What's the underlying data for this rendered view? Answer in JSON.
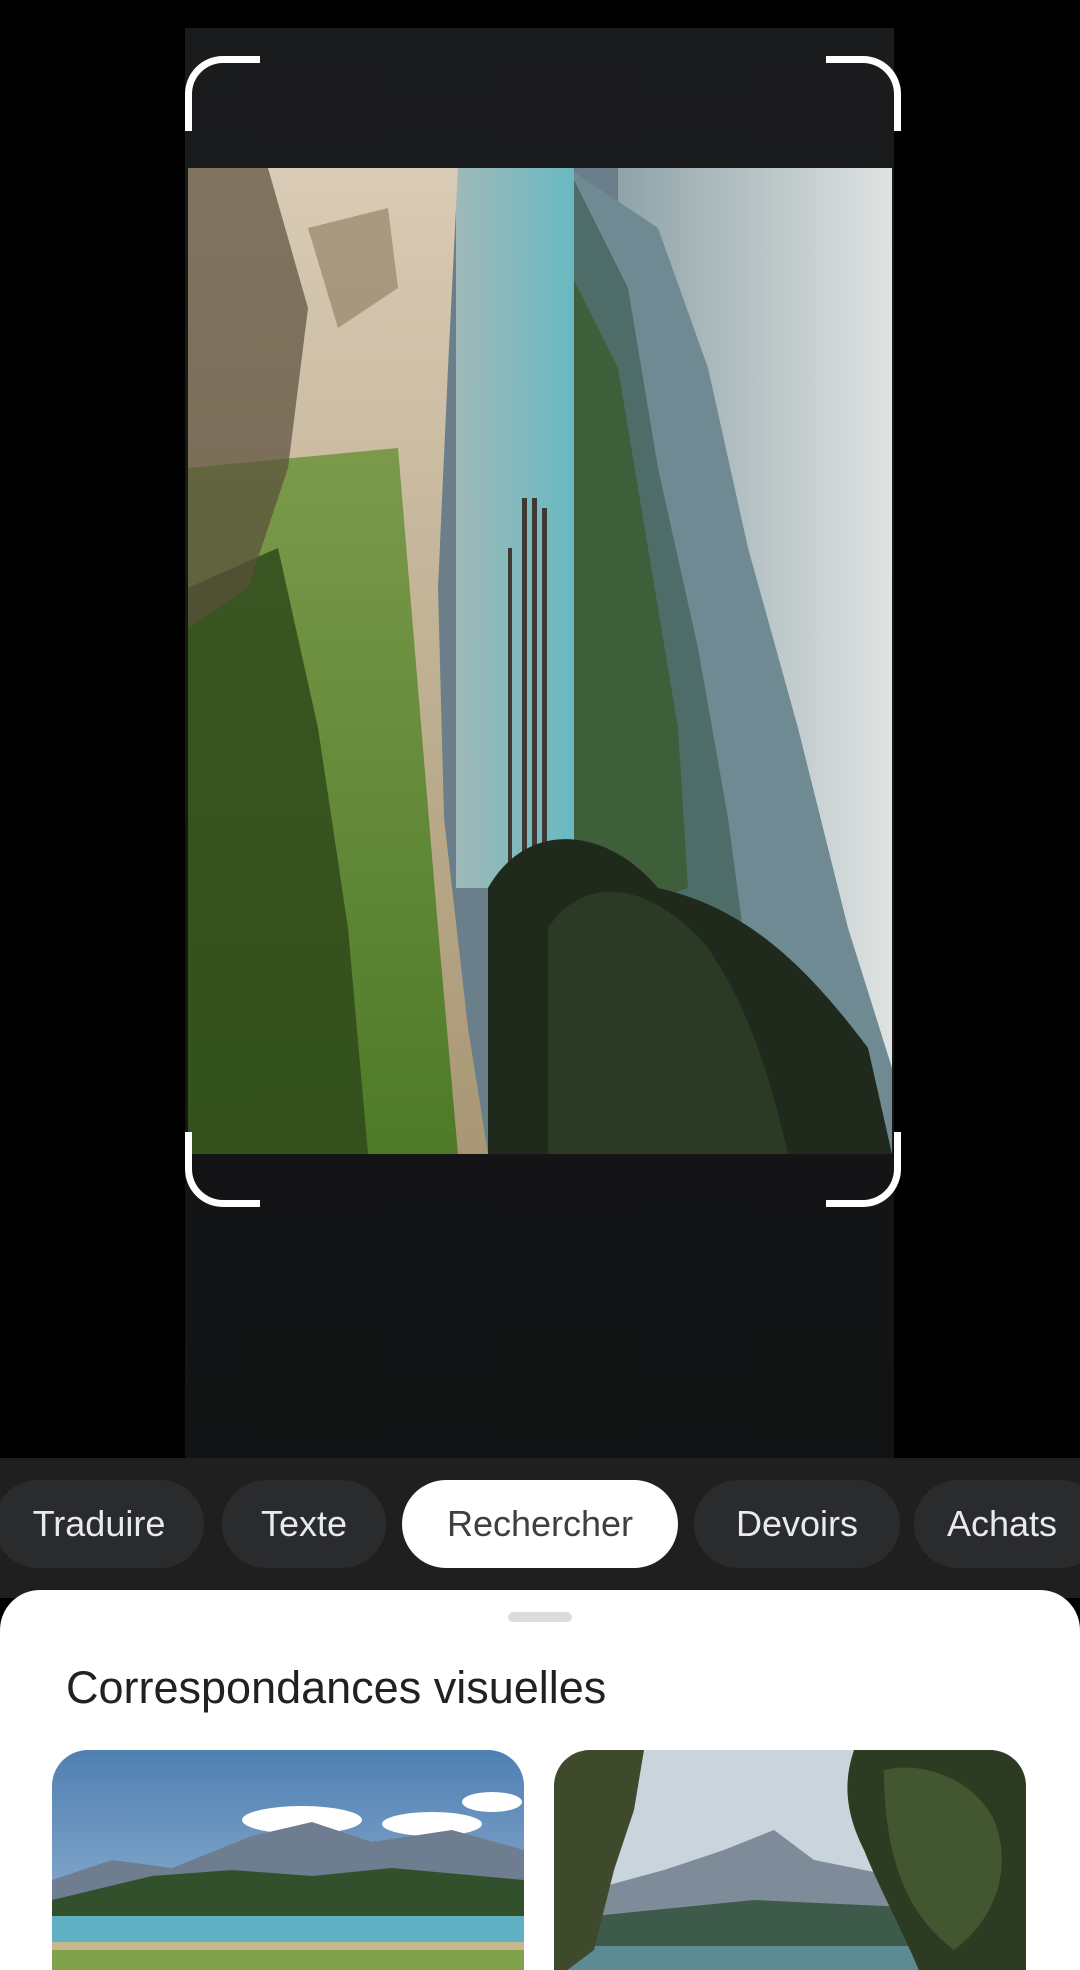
{
  "mode_tabs": [
    {
      "label": "Traduire",
      "active": false
    },
    {
      "label": "Texte",
      "active": false
    },
    {
      "label": "Rechercher",
      "active": true
    },
    {
      "label": "Devoirs",
      "active": false
    },
    {
      "label": "Achats",
      "active": false
    }
  ],
  "results_sheet": {
    "title": "Correspondances visuelles"
  },
  "colors": {
    "active_chip_bg": "#ffffff",
    "chip_bg": "#2a2b2d",
    "sheet_bg": "#ffffff",
    "text_dark": "#202124"
  }
}
